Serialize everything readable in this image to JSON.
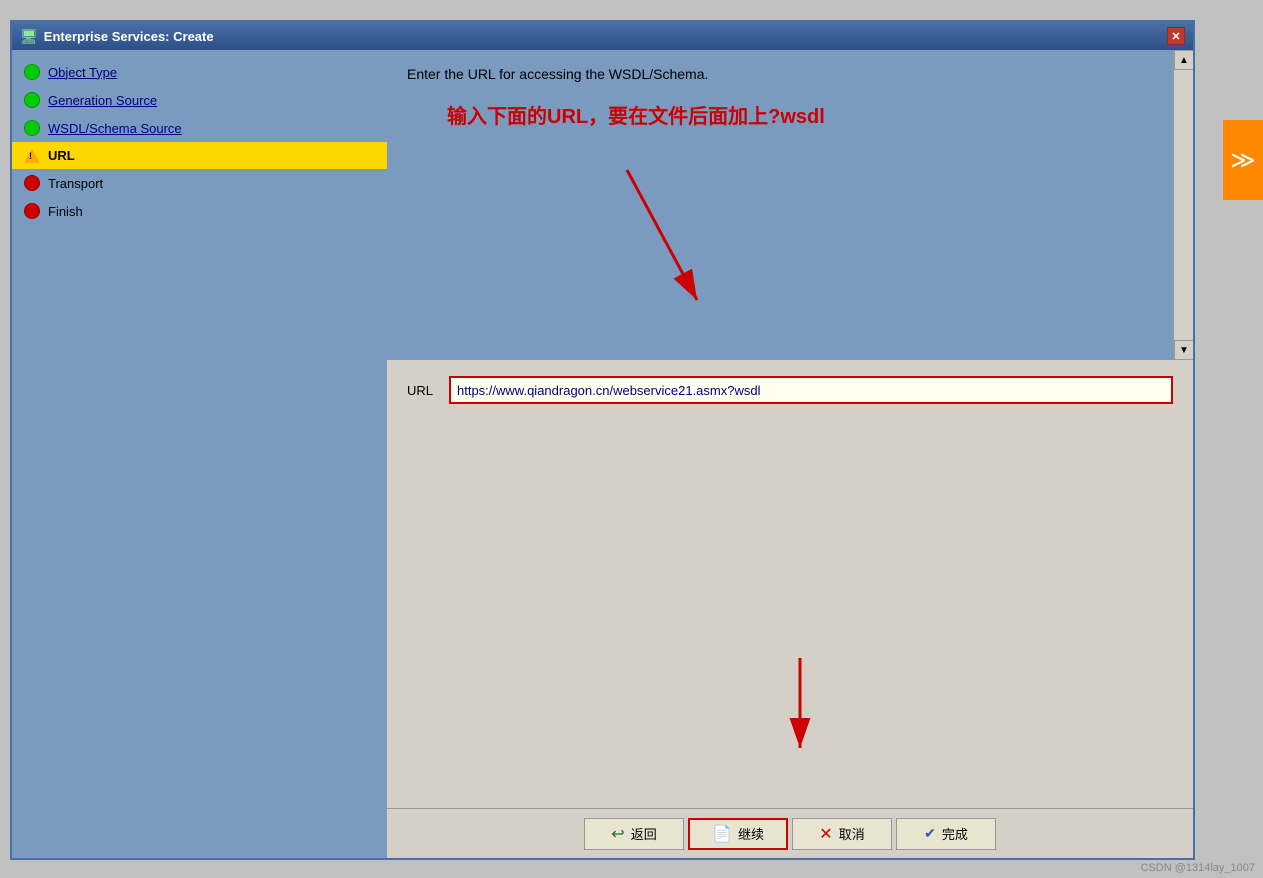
{
  "window": {
    "title": "Enterprise Services: Create",
    "title_icon": "🖥"
  },
  "sidebar": {
    "items": [
      {
        "id": "object-type",
        "label": "Object Type",
        "status": "green",
        "active": false
      },
      {
        "id": "generation-source",
        "label": "Generation Source",
        "status": "green",
        "active": false
      },
      {
        "id": "wsdl-schema-source",
        "label": "WSDL/Schema Source",
        "status": "green",
        "active": false
      },
      {
        "id": "url",
        "label": "URL",
        "status": "warning",
        "active": true
      },
      {
        "id": "transport",
        "label": "Transport",
        "status": "red",
        "active": false
      },
      {
        "id": "finish",
        "label": "Finish",
        "status": "red",
        "active": false
      }
    ]
  },
  "content": {
    "instruction": "Enter the URL for accessing the WSDL/Schema.",
    "annotation": "输入下面的URL，要在文件后面加上?wsdl",
    "url_label": "URL",
    "url_value": "https://www.qiandragon.cn/webservice21.asmx?wsdl"
  },
  "toolbar": {
    "back_label": "返回",
    "continue_label": "继续",
    "cancel_label": "取消",
    "finish_label": "完成"
  },
  "watermark": "CSDN @1314lay_1007"
}
